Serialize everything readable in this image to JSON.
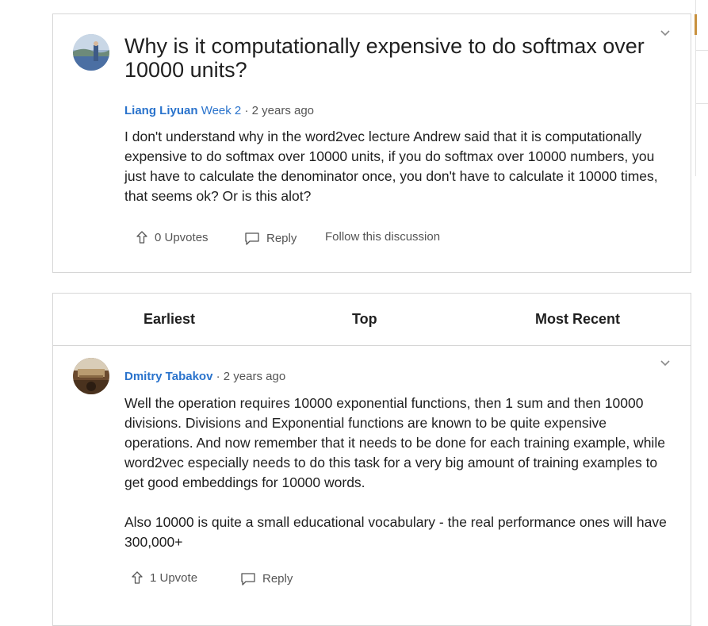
{
  "question": {
    "title": "Why is it computationally expensive to do softmax over 10000 units?",
    "author": "Liang Liyuan",
    "week": "Week 2",
    "separator": "·",
    "time": "2 years ago",
    "body": "I don't understand why in the word2vec lecture Andrew said that it is computationally expensive to do softmax over 10000 units, if you do softmax over 10000 numbers, you just have to calculate the denominator once, you don't have to calculate it 10000 times, that seems ok? Or is this alot?",
    "upvotes_label": "0 Upvotes",
    "reply_label": "Reply",
    "follow_label": "Follow this discussion"
  },
  "sort_tabs": [
    "Earliest",
    "Top",
    "Most Recent"
  ],
  "answer": {
    "author": "Dmitry Tabakov",
    "separator": "·",
    "time": "2 years ago",
    "paragraphs": [
      "Well the operation requires 10000 exponential functions, then 1 sum and then 10000 divisions. Divisions and Exponential functions are known to be quite expensive operations. And now remember that it needs to be done for each training example, while word2vec especially needs to do this task for a very big amount of training examples to get good embeddings for 10000 words.",
      "Also 10000 is quite a small educational vocabulary - the real performance ones will have 300,000+"
    ],
    "upvotes_label": "1 Upvote",
    "reply_label": "Reply"
  },
  "icons": [
    "chevron-down-icon",
    "avatar-image",
    "upvote-arrow-icon",
    "reply-bubble-icon"
  ],
  "colors": {
    "link": "#2a73cc",
    "border": "#d6d6d6",
    "accent": "#c8913e"
  }
}
